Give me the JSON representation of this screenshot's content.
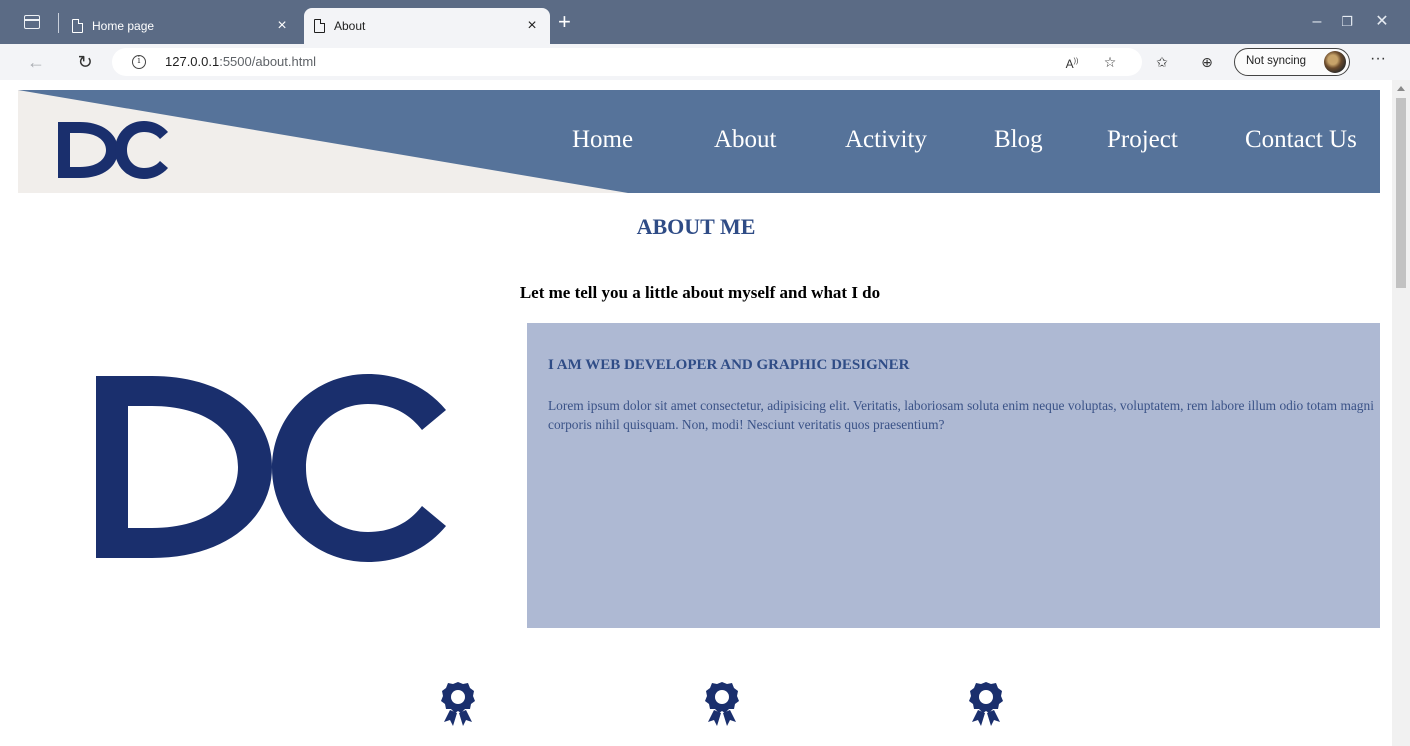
{
  "browser": {
    "tabs": [
      {
        "title": "Home page",
        "active": false
      },
      {
        "title": "About",
        "active": true
      }
    ],
    "new_tab_label": "+",
    "address": {
      "host": "127.0.0.1",
      "path": ":5500/about.html"
    },
    "profile": {
      "sync_label": "Not syncing"
    },
    "icons": [
      "tab-actions-icon",
      "page-icon",
      "close-icon",
      "new-tab-icon",
      "back-icon",
      "refresh-icon",
      "info-icon",
      "read-aloud-icon",
      "add-favorite-icon",
      "favorites-icon",
      "collections-icon",
      "more-icon",
      "minimize-icon",
      "restore-icon"
    ]
  },
  "site": {
    "logo_text": "DC",
    "nav": [
      "Home",
      "About",
      "Activity",
      "Blog",
      "Project",
      "Contact Us"
    ],
    "heading": "ABOUT ME",
    "intro": "Let me tell you a little about myself and what I do",
    "card": {
      "title": "I AM WEB DEVELOPER AND GRAPHIC DESIGNER",
      "text": "Lorem ipsum dolor sit amet consectetur, adipisicing elit. Veritatis, laboriosam soluta enim neque voluptas, voluptatem, rem labore illum odio totam magni corporis nihil quisquam. Non, modi! Nesciunt veritatis quos praesentium?"
    },
    "award_icon": "award-icon"
  },
  "colors": {
    "tabbar": "#5b6b85",
    "toolbar": "#f3f4f7",
    "header": "#56739a",
    "header_wedge": "#f1eeeb",
    "brand_navy": "#1a2f6d",
    "accent_text": "#2f4c86",
    "card_bg": "#aeb9d3"
  }
}
